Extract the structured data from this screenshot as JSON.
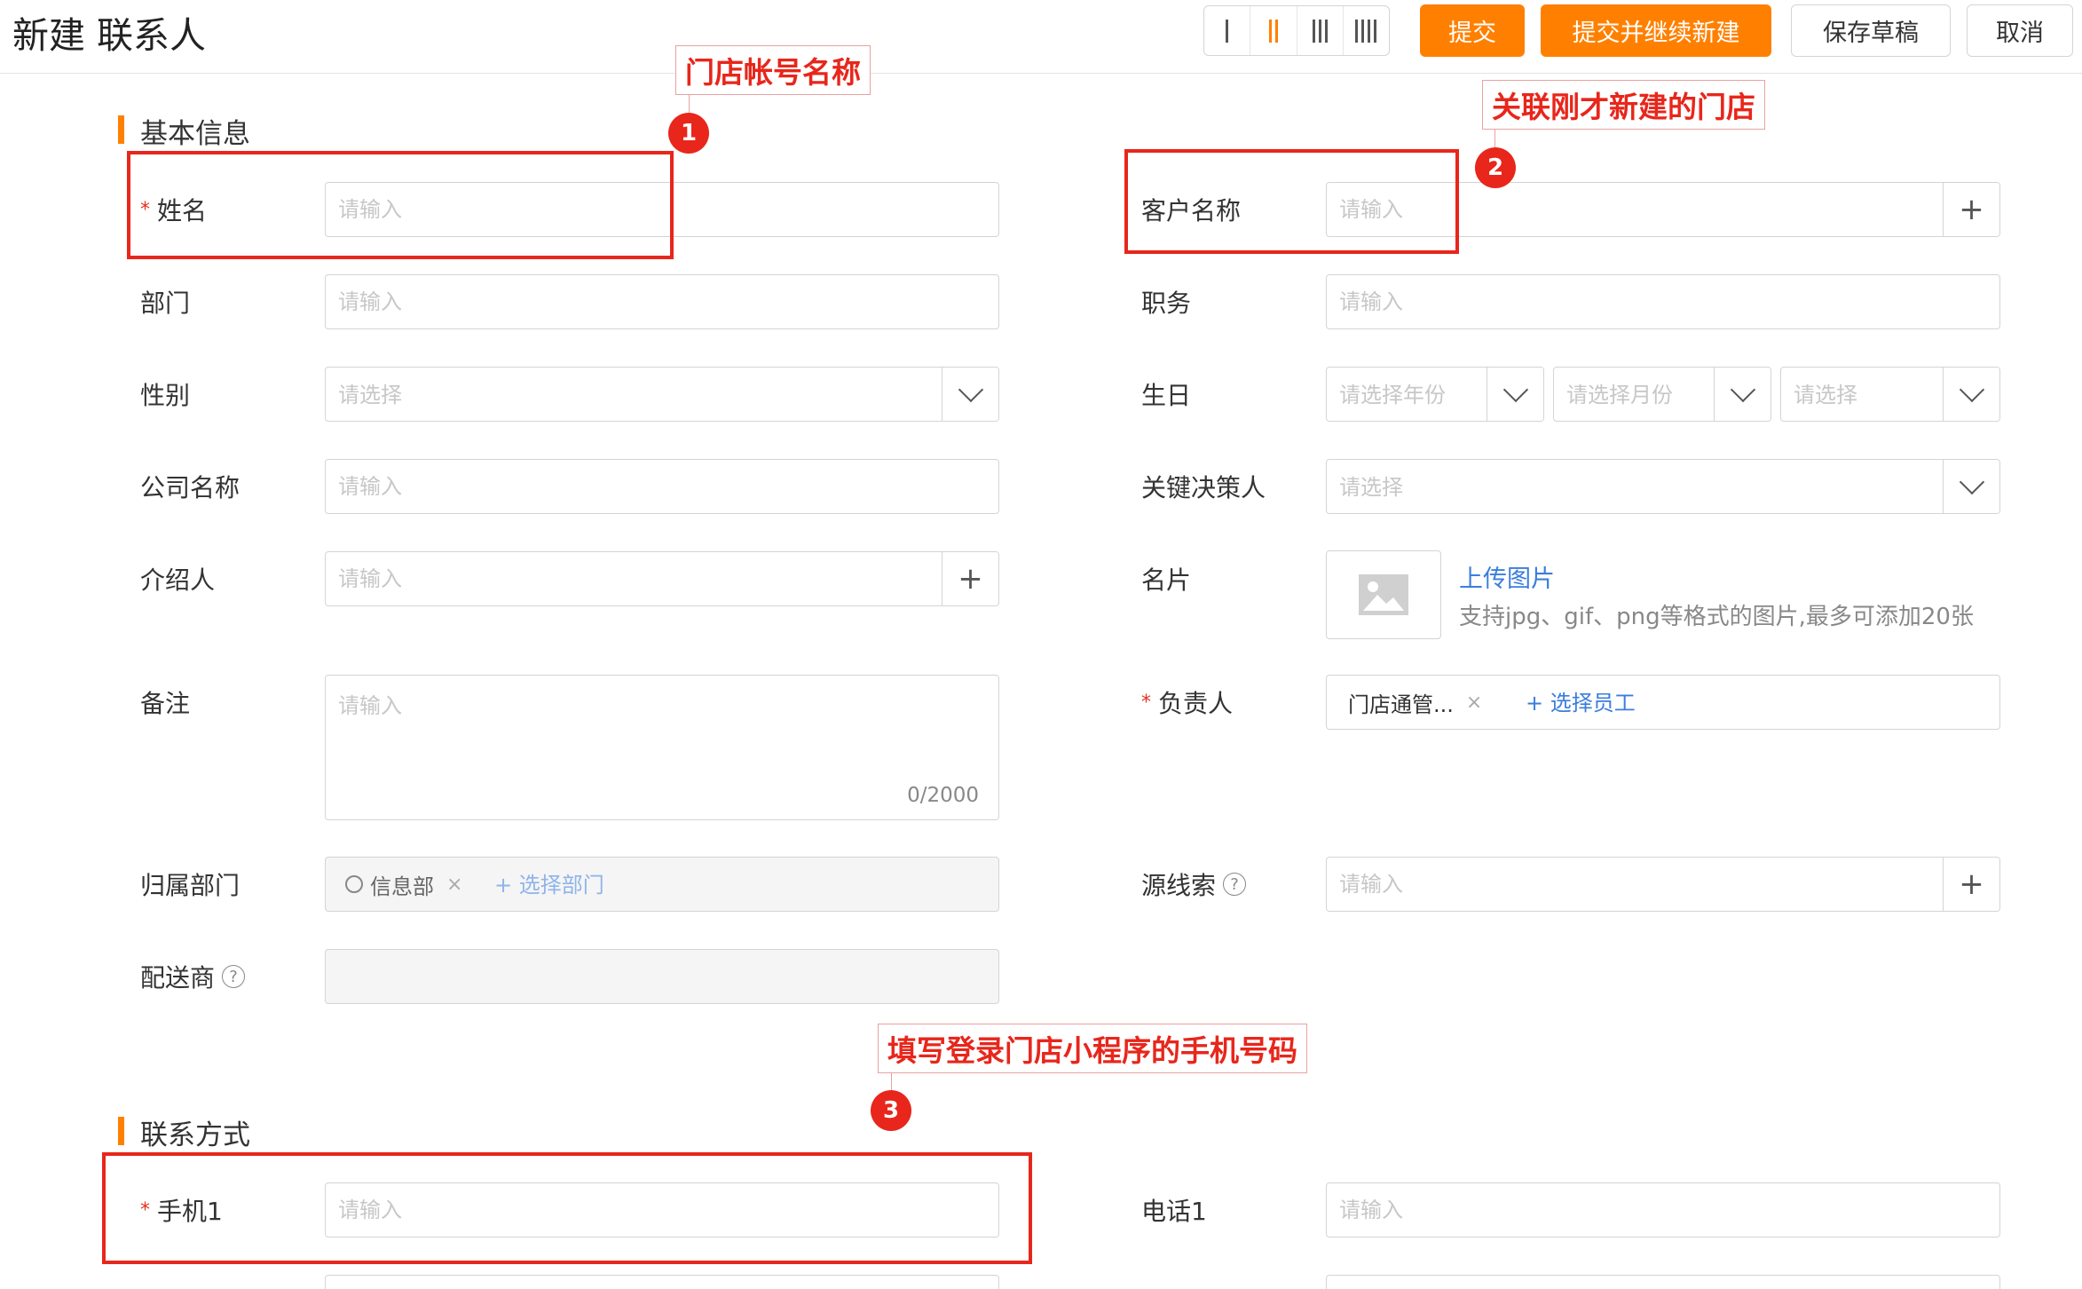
{
  "header": {
    "title": "新建 联系人",
    "column_options": [
      "I",
      "II",
      "III",
      "IIII"
    ],
    "active_column": "II",
    "buttons": {
      "submit": "提交",
      "submit_continue": "提交并继续新建",
      "save_draft": "保存草稿",
      "cancel": "取消"
    }
  },
  "basic_info": {
    "section_title": "基本信息",
    "name": {
      "label": "姓名",
      "required": true,
      "placeholder": "请输入"
    },
    "customer_name": {
      "label": "客户名称",
      "placeholder": "请输入"
    },
    "department": {
      "label": "部门",
      "placeholder": "请输入"
    },
    "position": {
      "label": "职务",
      "placeholder": "请输入"
    },
    "gender": {
      "label": "性别",
      "placeholder": "请选择"
    },
    "birthday": {
      "label": "生日",
      "year_placeholder": "请选择年份",
      "month_placeholder": "请选择月份",
      "day_placeholder": "请选择"
    },
    "company": {
      "label": "公司名称",
      "placeholder": "请输入"
    },
    "key_decision_maker": {
      "label": "关键决策人",
      "placeholder": "请选择"
    },
    "referrer": {
      "label": "介绍人",
      "placeholder": "请输入"
    },
    "business_card": {
      "label": "名片",
      "upload_label": "上传图片",
      "hint": "支持jpg、gif、png等格式的图片,最多可添加20张"
    },
    "remark": {
      "label": "备注",
      "placeholder": "请输入",
      "counter": "0/2000"
    },
    "owner": {
      "label": "负责人",
      "required": true,
      "tag": "门店通管...",
      "add_label": "+ 选择员工"
    },
    "owning_dept": {
      "label": "归属部门",
      "tag": "信息部",
      "add_label": "+ 选择部门"
    },
    "source_lead": {
      "label": "源线索",
      "placeholder": "请输入"
    },
    "distributor": {
      "label": "配送商"
    }
  },
  "contact": {
    "section_title": "联系方式",
    "mobile1": {
      "label": "手机1",
      "required": true,
      "placeholder": "请输入"
    },
    "phone1": {
      "label": "电话1",
      "placeholder": "请输入"
    }
  },
  "annotations": {
    "note1": "门店帐号名称",
    "note2": "关联刚才新建的门店",
    "note3": "填写登录门店小程序的手机号码",
    "marker1": "1",
    "marker2": "2",
    "marker3": "3"
  },
  "symbols": {
    "required_mark": "*",
    "help": "?",
    "remove": "×",
    "plus": "+"
  },
  "colors": {
    "accent": "#ff8000",
    "annotation": "#e8261b",
    "link": "#3b7ddd",
    "required": "#e0321e"
  }
}
